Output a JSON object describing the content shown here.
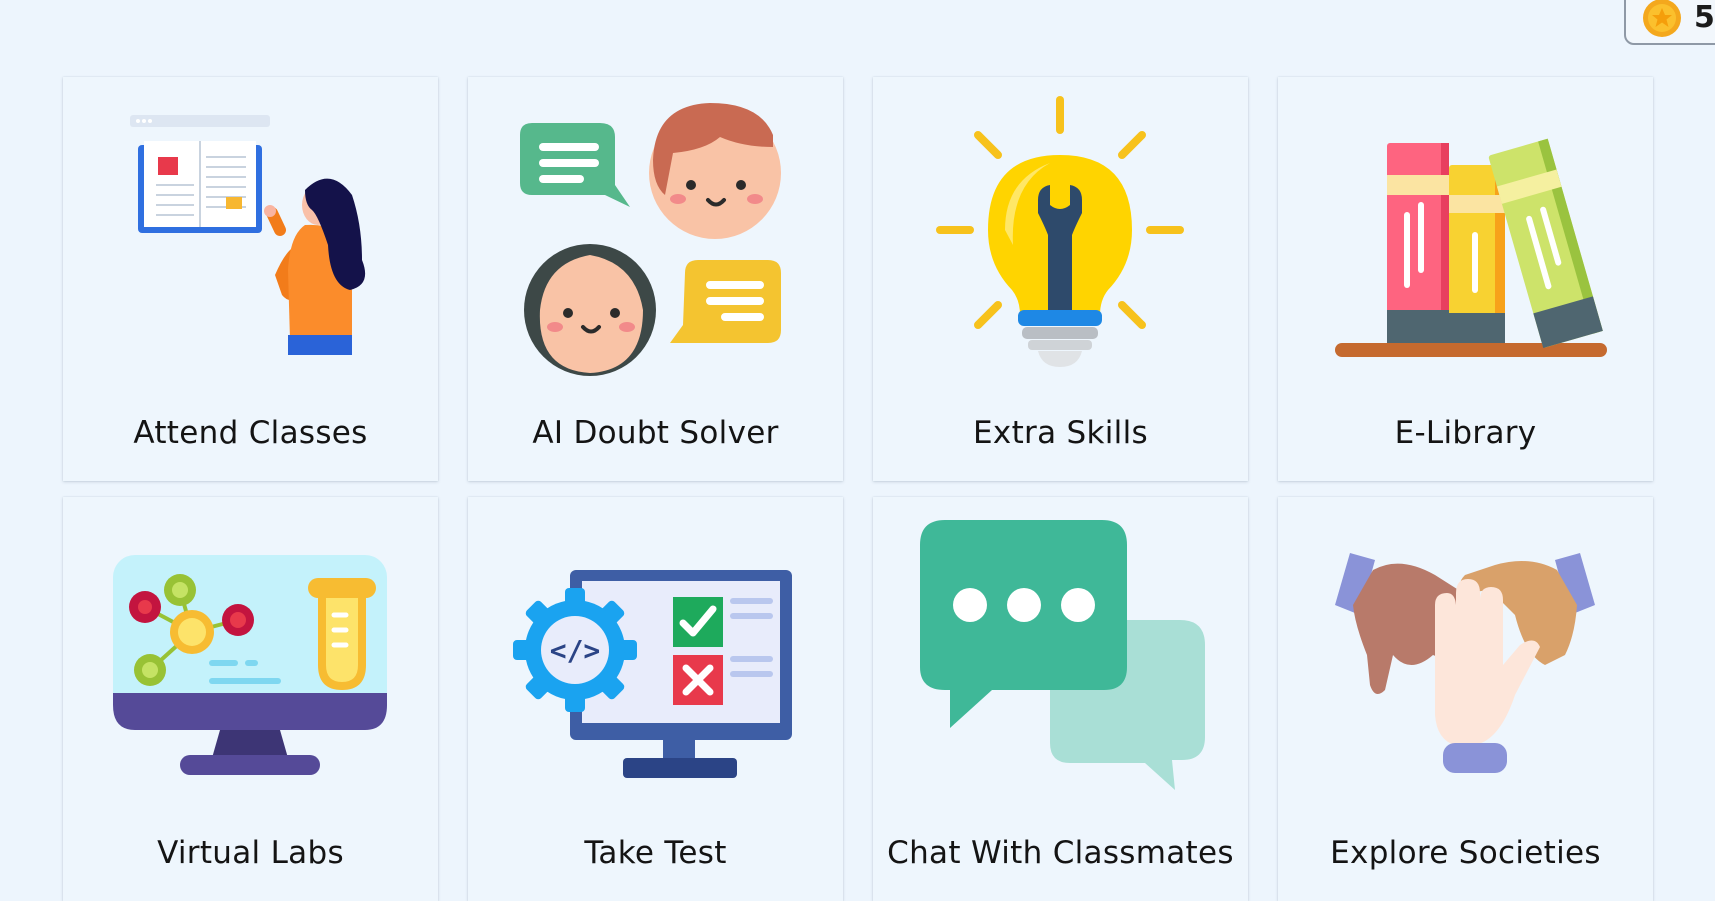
{
  "header": {
    "coin_badge": {
      "count": "5",
      "icon": "gold-coin-icon"
    }
  },
  "menu": {
    "cards": [
      {
        "label": "Attend Classes",
        "icon": "book-reading-student-icon"
      },
      {
        "label": "AI Doubt Solver",
        "icon": "chat-faces-icon"
      },
      {
        "label": "Extra Skills",
        "icon": "lightbulb-wrench-icon"
      },
      {
        "label": "E-Library",
        "icon": "books-shelf-icon"
      },
      {
        "label": "Virtual Labs",
        "icon": "lab-monitor-icon"
      },
      {
        "label": "Take Test",
        "icon": "test-monitor-icon"
      },
      {
        "label": "Chat With Classmates",
        "icon": "chat-bubbles-icon"
      },
      {
        "label": "Explore Societies",
        "icon": "teamwork-hands-icon"
      }
    ]
  },
  "colors": {
    "background": "#edf5fd",
    "card": "#eef6fd",
    "text": "#141414"
  }
}
